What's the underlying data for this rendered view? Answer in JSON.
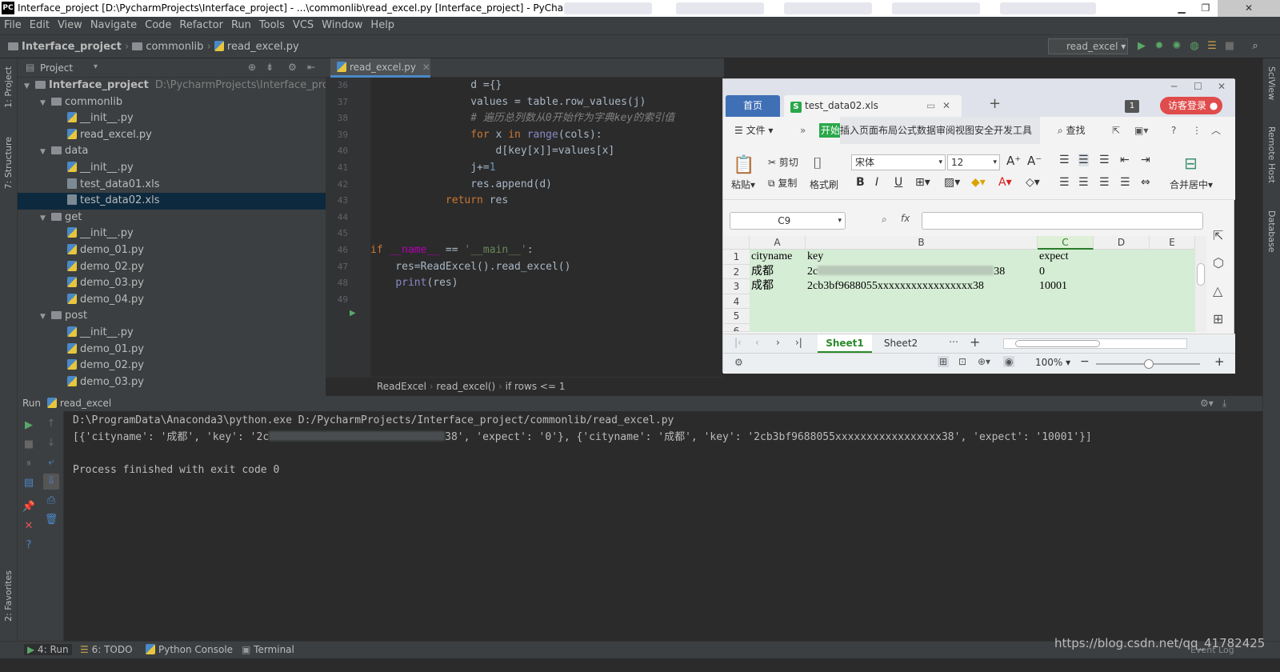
{
  "window": {
    "title": "Interface_project [D:\\PycharmProjects\\Interface_project] - ...\\commonlib\\read_excel.py [Interface_project] - PyCharm",
    "app_icon": "PC"
  },
  "menu": [
    "File",
    "Edit",
    "View",
    "Navigate",
    "Code",
    "Refactor",
    "Run",
    "Tools",
    "VCS",
    "Window",
    "Help"
  ],
  "breadcrumb": {
    "project": "Interface_project",
    "folder": "commonlib",
    "file": "read_excel.py"
  },
  "run_config": "read_excel",
  "left_tabs": {
    "project": "1: Project",
    "structure": "7: Structure",
    "favorites": "2: Favorites"
  },
  "right_tabs": {
    "sciview": "SciView",
    "remote": "Remote Host",
    "database": "Database"
  },
  "project_panel": {
    "title": "Project",
    "tree": [
      {
        "label": "Interface_project",
        "path": "D:\\PycharmProjects\\Interface_project",
        "kind": "folder",
        "level": 0,
        "open": true
      },
      {
        "label": "commonlib",
        "kind": "folder",
        "level": 1,
        "open": true
      },
      {
        "label": "__init__.py",
        "kind": "py",
        "level": 2
      },
      {
        "label": "read_excel.py",
        "kind": "py",
        "level": 2
      },
      {
        "label": "data",
        "kind": "folder",
        "level": 1,
        "open": true
      },
      {
        "label": "__init__.py",
        "kind": "py",
        "level": 2
      },
      {
        "label": "test_data01.xls",
        "kind": "xls",
        "level": 2
      },
      {
        "label": "test_data02.xls",
        "kind": "xls",
        "level": 2,
        "selected": true
      },
      {
        "label": "get",
        "kind": "folder",
        "level": 1,
        "open": true
      },
      {
        "label": "__init__.py",
        "kind": "py",
        "level": 2
      },
      {
        "label": "demo_01.py",
        "kind": "py",
        "level": 2
      },
      {
        "label": "demo_02.py",
        "kind": "py",
        "level": 2
      },
      {
        "label": "demo_03.py",
        "kind": "py",
        "level": 2
      },
      {
        "label": "demo_04.py",
        "kind": "py",
        "level": 2
      },
      {
        "label": "post",
        "kind": "folder",
        "level": 1,
        "open": true
      },
      {
        "label": "__init__.py",
        "kind": "py",
        "level": 2
      },
      {
        "label": "demo_01.py",
        "kind": "py",
        "level": 2
      },
      {
        "label": "demo_02.py",
        "kind": "py",
        "level": 2
      },
      {
        "label": "demo_03.py",
        "kind": "py",
        "level": 2
      }
    ]
  },
  "editor": {
    "tab": "read_excel.py",
    "line_numbers": [
      "36",
      "37",
      "38",
      "39",
      "40",
      "41",
      "42",
      "43",
      "44",
      "45",
      "46",
      "47",
      "48",
      "49"
    ],
    "code_lines": [
      "                d ={}",
      "                values = table.row_values(j)",
      "                # 遍历总列数从0开始作为字典key的索引值",
      "                for x in range(cols):",
      "                    d[key[x]]=values[x]",
      "                j+=1",
      "                res.append(d)",
      "            return res",
      "",
      "",
      "if __name__ == '__main__':",
      "    res=ReadExcel().read_excel()",
      "    print(res)",
      ""
    ],
    "crumbs": [
      "ReadExcel",
      "read_excel()",
      "if rows <= 1"
    ]
  },
  "wps": {
    "home_tab": "首页",
    "file_tab": "test_data02.xls",
    "login": "访客登录",
    "badge": "1",
    "menu": {
      "file": "文件",
      "start": "开始",
      "items": "插入页面布局公式数据审阅视图安全开发工具",
      "find": "查找"
    },
    "ribbon": {
      "paste": "粘贴",
      "cut": "剪切",
      "copy": "复制",
      "format_painter": "格式刷",
      "font": "宋体",
      "size": "12",
      "merge": "合并居中"
    },
    "cell_ref": "C9",
    "fx": "fx",
    "columns": [
      "A",
      "B",
      "C",
      "D",
      "E"
    ],
    "rows": [
      "1",
      "2",
      "3",
      "4",
      "5",
      "6"
    ],
    "cells": [
      [
        "cityname",
        "key",
        "expect"
      ],
      [
        "成都",
        "2c",
        "0"
      ],
      [
        "成都",
        "2cb3bf9688055xxxxxxxxxxxxxxxxx38",
        "10001"
      ]
    ],
    "cell_b2_tail": "38",
    "sheets": [
      "Sheet1",
      "Sheet2"
    ],
    "zoom": "100%"
  },
  "run": {
    "title": "Run",
    "config": "read_excel",
    "output": [
      "D:\\ProgramData\\Anaconda3\\python.exe D:/PycharmProjects/Interface_project/commonlib/read_excel.py",
      "[{'cityname': '成都', 'key': '2c",
      "38', 'expect': '0'}, {'cityname': '成都', 'key': '2cb3bf9688055xxxxxxxxxxxxxxxxx38', 'expect': '10001'}]",
      "",
      "Process finished with exit code 0"
    ]
  },
  "bottom_tabs": {
    "run": "4: Run",
    "todo": "6: TODO",
    "console": "Python Console",
    "terminal": "Terminal",
    "event_log": "Event Log"
  },
  "watermark": "https://blog.csdn.net/qq_41782425"
}
